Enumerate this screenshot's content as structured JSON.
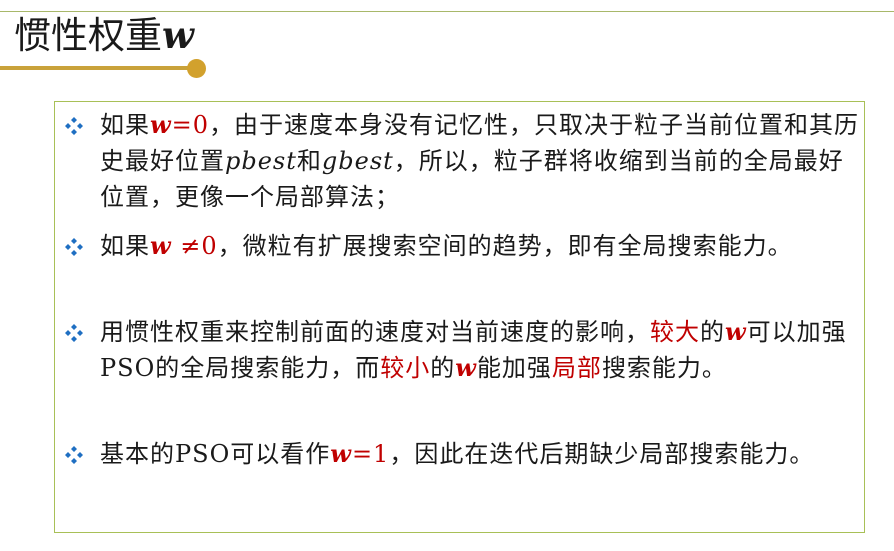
{
  "title": {
    "text": "惯性权重",
    "var": "w"
  },
  "items": [
    {
      "segments": [
        {
          "t": "如果"
        },
        {
          "t": "w",
          "c": "red var-i"
        },
        {
          "t": "=0",
          "c": "red"
        },
        {
          "t": "，由于速度本身没有记忆性，只取决于粒子当前位置和其历史最好位置"
        },
        {
          "t": "pbest",
          "c": "ital"
        },
        {
          "t": "和"
        },
        {
          "t": "gbest",
          "c": "ital"
        },
        {
          "t": "，所以，粒子群将收缩到当前的全局最好位置，更像一个局部算法；"
        }
      ]
    },
    {
      "segments": [
        {
          "t": "如果"
        },
        {
          "t": "w",
          "c": "red var-i"
        },
        {
          "t": " ≠0",
          "c": "red"
        },
        {
          "t": "，微粒有扩展搜索空间的趋势，即有全局搜索能力。"
        }
      ]
    },
    {
      "segments": [
        {
          "t": "用惯性权重来控制前面的速度对当前速度的影响，"
        },
        {
          "t": "较大",
          "c": "red"
        },
        {
          "t": "的"
        },
        {
          "t": "w",
          "c": "red var-i"
        },
        {
          "t": "可以加强PSO的全局搜索能力，而"
        },
        {
          "t": "较小",
          "c": "red"
        },
        {
          "t": "的"
        },
        {
          "t": "w",
          "c": "red var-i"
        },
        {
          "t": "能加强"
        },
        {
          "t": "局部",
          "c": "red"
        },
        {
          "t": "搜索能力。"
        }
      ]
    },
    {
      "segments": [
        {
          "t": "基本的PSO可以看作"
        },
        {
          "t": "w",
          "c": "red var-i"
        },
        {
          "t": "=1",
          "c": "red"
        },
        {
          "t": "，因此在迭代后期缺少局部搜索能力。"
        }
      ]
    }
  ],
  "colors": {
    "accent_red": "#c00000",
    "border_green": "#a8c057",
    "bullet_blue": "#1f6fc2",
    "underline_gold": "#d2a12d"
  },
  "icons": {
    "bullet": "four-diamond-bullet-icon"
  }
}
